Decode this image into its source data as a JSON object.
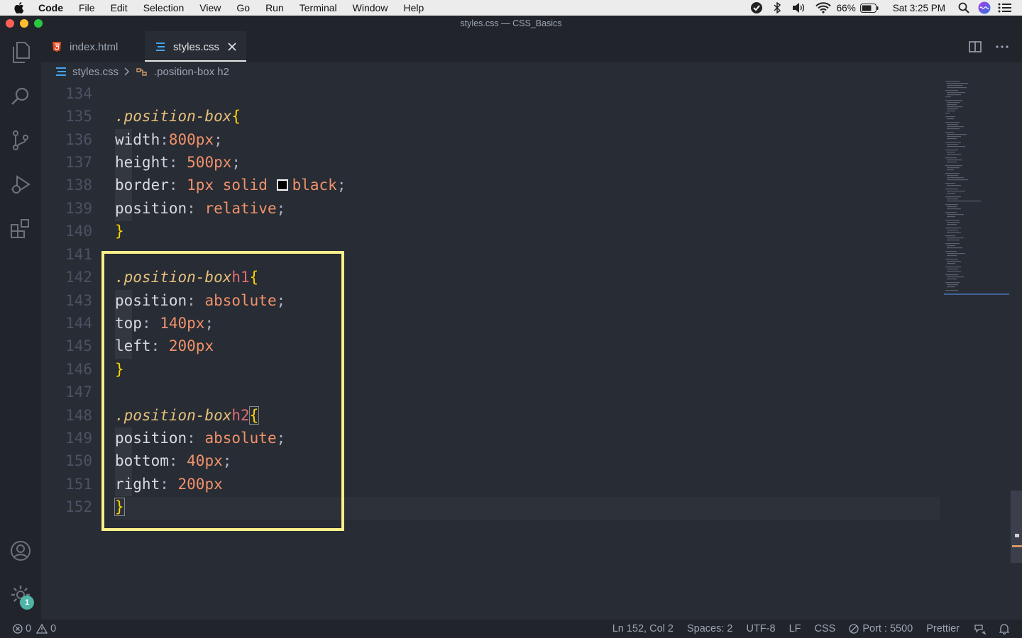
{
  "menubar": {
    "app_name": "Code",
    "items": [
      "File",
      "Edit",
      "Selection",
      "View",
      "Go",
      "Run",
      "Terminal",
      "Window",
      "Help"
    ],
    "battery": "66%",
    "clock": "Sat 3:25 PM"
  },
  "window": {
    "title": "styles.css — CSS_Basics"
  },
  "tabs": [
    {
      "label": "index.html",
      "icon": "html5-icon",
      "active": false
    },
    {
      "label": "styles.css",
      "icon": "css3-icon",
      "active": true
    }
  ],
  "breadcrumb": {
    "file": "styles.css",
    "symbol": ".position-box h2"
  },
  "editor": {
    "line_numbers": [
      "134",
      "135",
      "136",
      "137",
      "138",
      "139",
      "140",
      "141",
      "142",
      "143",
      "144",
      "145",
      "146",
      "147",
      "148",
      "149",
      "150",
      "151",
      "152"
    ],
    "current_line": "152"
  },
  "statusbar": {
    "errors": "0",
    "warnings": "0",
    "cursor": "Ln 152, Col 2",
    "spaces": "Spaces: 2",
    "encoding": "UTF-8",
    "eol": "LF",
    "language": "CSS",
    "port": "Port : 5500",
    "formatter": "Prettier"
  },
  "activity_bar": {
    "settings_badge": "1"
  },
  "colors": {
    "accent_highlight": "#faf089",
    "editor_bg": "#282c34"
  }
}
